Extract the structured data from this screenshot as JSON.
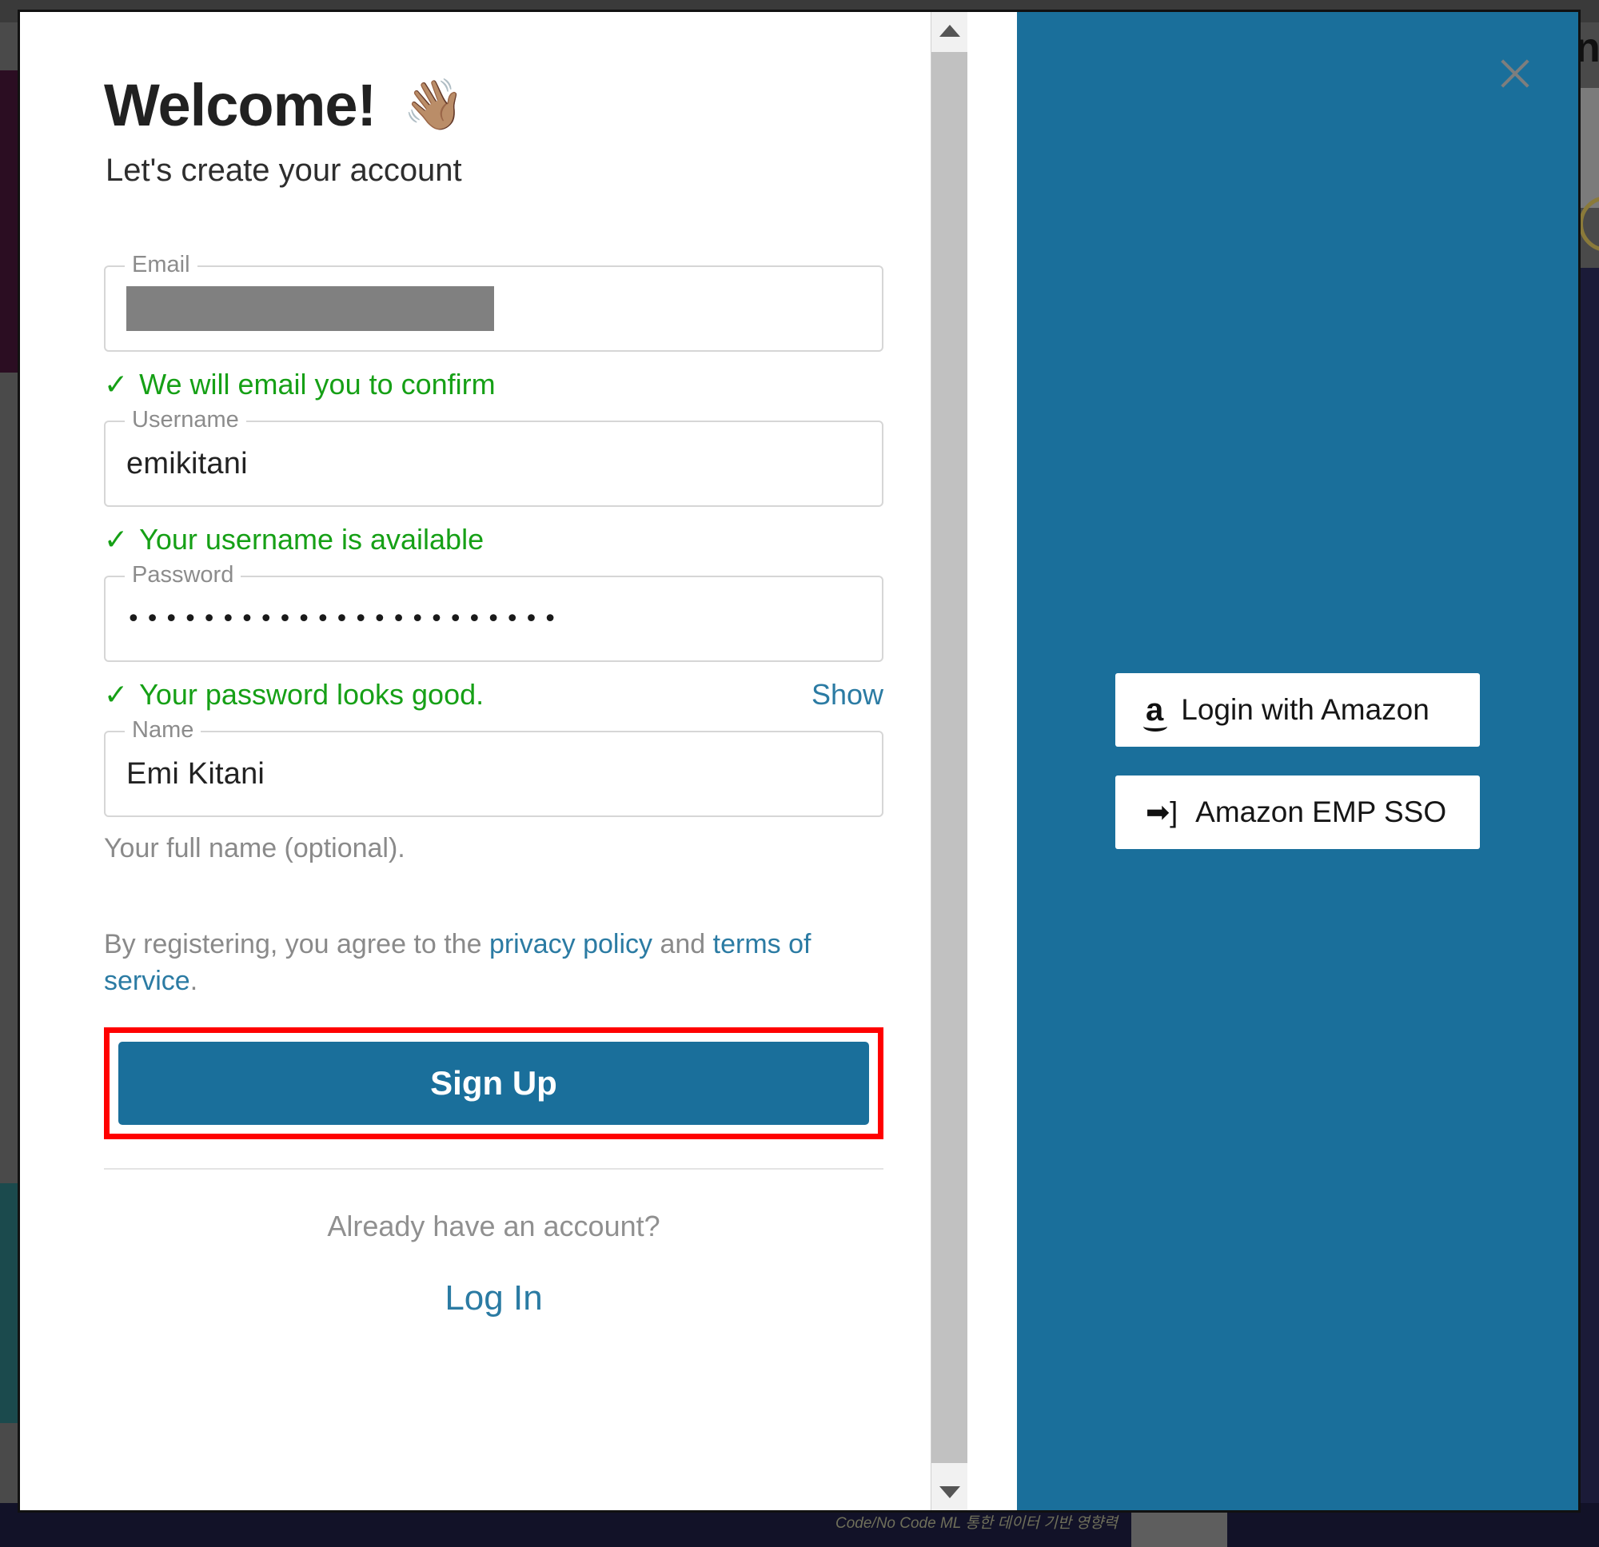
{
  "modal": {
    "title": "Welcome!",
    "wave_icon": "👋🏽",
    "subtitle": "Let's create your account"
  },
  "form": {
    "email": {
      "legend": "Email",
      "value": "",
      "redacted": true,
      "hint": "We will email you to confirm",
      "hint_status": "success"
    },
    "username": {
      "legend": "Username",
      "value": "emikitani",
      "hint": "Your username is available",
      "hint_status": "success"
    },
    "password": {
      "legend": "Password",
      "value": "•••••••••••••••••••••••",
      "hint": "Your password looks good.",
      "hint_status": "success",
      "show_label": "Show"
    },
    "name": {
      "legend": "Name",
      "value": "Emi Kitani",
      "hint": "Your full name (optional)."
    },
    "legal": {
      "prefix": "By registering, you agree to the ",
      "privacy_link": "privacy policy",
      "middle": " and ",
      "terms_link": "terms of service",
      "suffix": "."
    },
    "signup_button": "Sign Up",
    "already_text": "Already have an account?",
    "login_link": "Log In"
  },
  "side_panel": {
    "close_icon": "close-icon",
    "buttons": [
      {
        "label": "Login with Amazon",
        "icon": "amazon-a-icon",
        "glyph": "a"
      },
      {
        "label": "Amazon EMP SSO",
        "icon": "sso-arrow-icon",
        "glyph": "➡]"
      }
    ]
  },
  "scrollbar": {
    "up_arrow": "scroll-up-arrow",
    "down_arrow": "scroll-down-arrow"
  },
  "background": {
    "caption": "Code/No Code ML 통한 데이터 기반 영향력",
    "letter": "n"
  },
  "colors": {
    "accent_teal": "#1a6f9b",
    "success_green": "#16a016",
    "link_blue": "#2b7ba3",
    "highlight_red": "#ff0000",
    "redaction_grey": "#808080"
  }
}
